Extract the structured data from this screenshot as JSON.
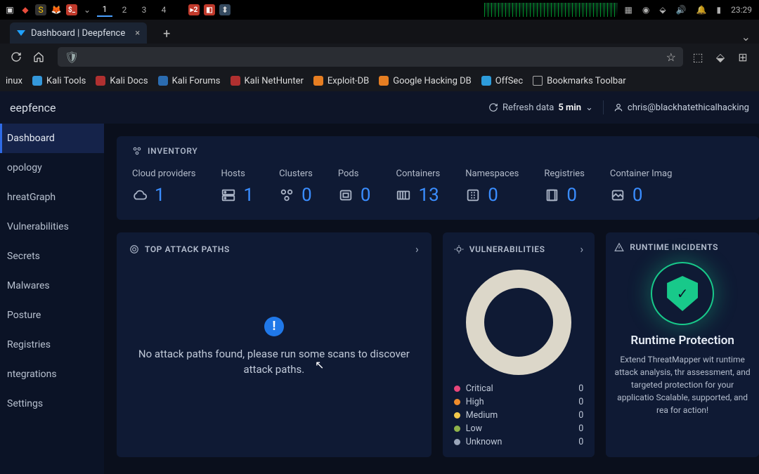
{
  "os": {
    "time": "23:29",
    "workspaces": [
      "1",
      "2",
      "3",
      "4"
    ]
  },
  "browser": {
    "tab_title": "Dashboard | Deepfence",
    "close_glyph": "×",
    "newtab_glyph": "+",
    "bookmarks": [
      {
        "label": "inux"
      },
      {
        "label": "Kali Tools"
      },
      {
        "label": "Kali Docs"
      },
      {
        "label": "Kali Forums"
      },
      {
        "label": "Kali NetHunter"
      },
      {
        "label": "Exploit-DB"
      },
      {
        "label": "Google Hacking DB"
      },
      {
        "label": "OffSec"
      },
      {
        "label": "Bookmarks Toolbar"
      }
    ]
  },
  "header": {
    "logo": "eepfence",
    "refresh_label": "Refresh data",
    "refresh_interval": "5 min",
    "user": "chris@blackhatethicalhacking"
  },
  "sidebar": {
    "items": [
      {
        "label": "Dashboard"
      },
      {
        "label": "opology"
      },
      {
        "label": "hreatGraph"
      },
      {
        "label": "Vulnerabilities"
      },
      {
        "label": "Secrets"
      },
      {
        "label": "Malwares"
      },
      {
        "label": "Posture"
      },
      {
        "label": "Registries"
      },
      {
        "label": "ntegrations"
      },
      {
        "label": "Settings"
      }
    ]
  },
  "inventory": {
    "title": "INVENTORY",
    "stats": [
      {
        "label": "Cloud providers",
        "value": "1",
        "icon": "cloud"
      },
      {
        "label": "Hosts",
        "value": "1",
        "icon": "server"
      },
      {
        "label": "Clusters",
        "value": "0",
        "icon": "cluster"
      },
      {
        "label": "Pods",
        "value": "0",
        "icon": "pod"
      },
      {
        "label": "Containers",
        "value": "13",
        "icon": "container"
      },
      {
        "label": "Namespaces",
        "value": "0",
        "icon": "namespace"
      },
      {
        "label": "Registries",
        "value": "0",
        "icon": "registry"
      },
      {
        "label": "Container Imag",
        "value": "0",
        "icon": "image"
      }
    ]
  },
  "attack": {
    "title": "TOP ATTACK PATHS",
    "empty_msg": "No attack paths found, please run some scans to discover attack paths."
  },
  "vuln": {
    "title": "VULNERABILITIES",
    "legend": [
      {
        "name": "Critical",
        "count": "0",
        "cls": "d-crit"
      },
      {
        "name": "High",
        "count": "0",
        "cls": "d-high"
      },
      {
        "name": "Medium",
        "count": "0",
        "cls": "d-med"
      },
      {
        "name": "Low",
        "count": "0",
        "cls": "d-low"
      },
      {
        "name": "Unknown",
        "count": "0",
        "cls": "d-unk"
      }
    ]
  },
  "runtime": {
    "title": "RUNTIME INCIDENTS",
    "heading": "Runtime Protection",
    "desc": "Extend ThreatMapper wit runtime attack analysis, thr assessment, and targeted protection for your applicatio Scalable, supported, and rea for action!"
  }
}
